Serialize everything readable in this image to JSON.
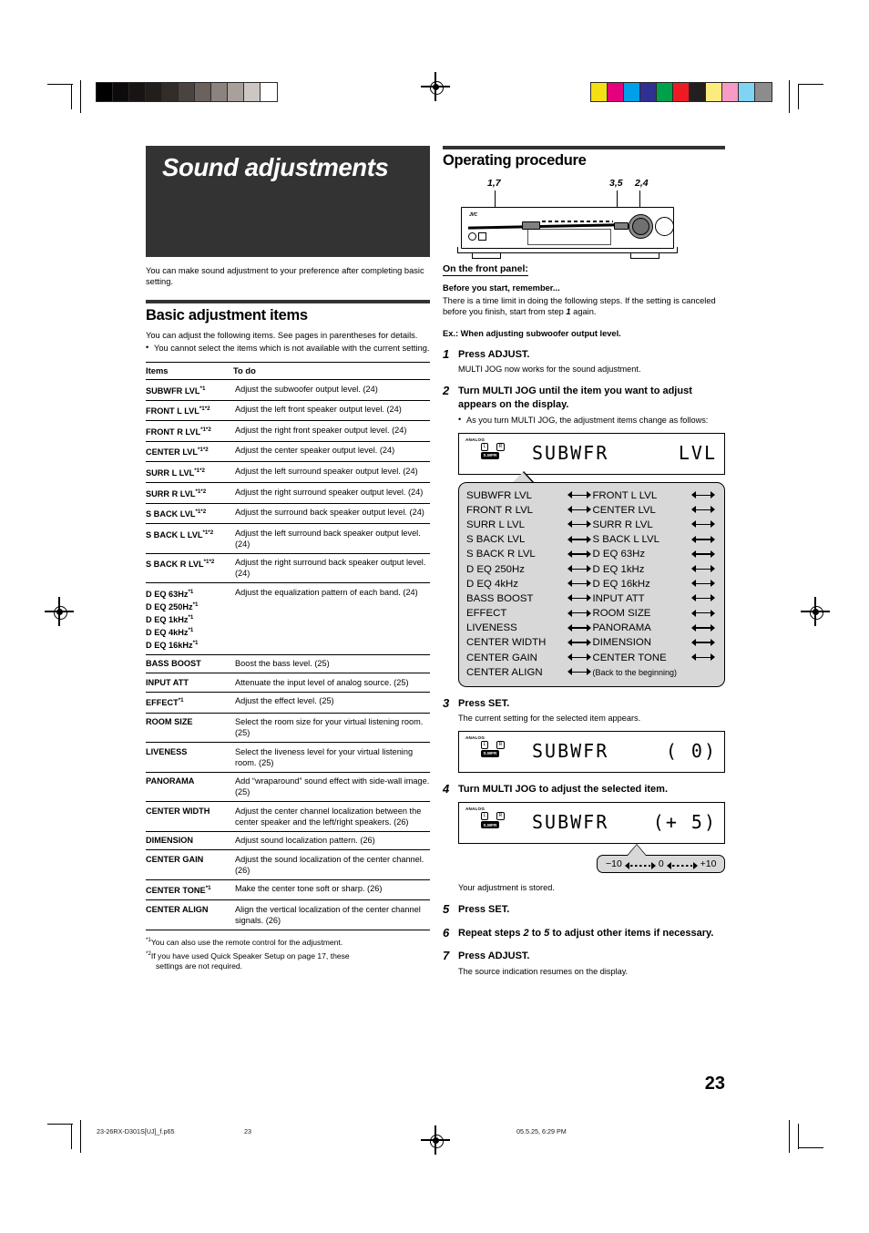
{
  "document": {
    "chapter_title": "Sound adjustments",
    "intro": "You can make sound adjustment to your preference after completing basic setting.",
    "page_number": "23"
  },
  "left_column": {
    "section_title": "Basic adjustment items",
    "lead": "You can adjust the following items. See pages in parentheses for details.",
    "bullet": "You cannot select the items which is not available with the current setting.",
    "table": {
      "headers": [
        "Items",
        "To do"
      ],
      "rows": [
        {
          "item": "SUBWFR LVL",
          "sup": "*1",
          "todo": "Adjust the subwoofer output level. (24)"
        },
        {
          "item": "FRONT L LVL",
          "sup": "*1*2",
          "todo": "Adjust the left front speaker output level. (24)"
        },
        {
          "item": "FRONT R LVL",
          "sup": "*1*2",
          "todo": "Adjust the right front speaker output level. (24)"
        },
        {
          "item": "CENTER LVL",
          "sup": "*1*2",
          "todo": "Adjust the center speaker output level. (24)"
        },
        {
          "item": "SURR L LVL",
          "sup": "*1*2",
          "todo": "Adjust the left surround speaker output level. (24)"
        },
        {
          "item": "SURR R LVL",
          "sup": "*1*2",
          "todo": "Adjust the right surround speaker output level. (24)"
        },
        {
          "item": "S BACK LVL",
          "sup": "*1*2",
          "todo": "Adjust the surround back speaker output level. (24)"
        },
        {
          "item": "S BACK L LVL",
          "sup": "*1*2",
          "todo": "Adjust the left surround back speaker output level. (24)"
        },
        {
          "item": "S BACK R LVL",
          "sup": "*1*2",
          "todo": "Adjust the right surround back speaker output level. (24)"
        },
        {
          "item": "D EQ 63Hz",
          "sup": "*1",
          "item2": "D EQ 250Hz",
          "sup2": "*1",
          "item3": "D EQ 1kHz",
          "sup3": "*1",
          "item4": "D EQ 4kHz",
          "sup4": "*1",
          "item5": "D EQ 16kHz",
          "sup5": "*1",
          "todo": "Adjust the equalization pattern of each band. (24)"
        },
        {
          "item": "BASS BOOST",
          "sup": "",
          "todo": "Boost the bass level. (25)"
        },
        {
          "item": "INPUT ATT",
          "sup": "",
          "todo": "Attenuate the input level of analog source. (25)"
        },
        {
          "item": "EFFECT",
          "sup": "*1",
          "todo": "Adjust the effect level. (25)"
        },
        {
          "item": "ROOM SIZE",
          "sup": "",
          "todo": "Select the room size for your virtual listening room. (25)"
        },
        {
          "item": "LIVENESS",
          "sup": "",
          "todo": "Select the liveness level for your virtual listening room. (25)"
        },
        {
          "item": "PANORAMA",
          "sup": "",
          "todo": "Add “wraparound” sound effect with side-wall image. (25)"
        },
        {
          "item": "CENTER WIDTH",
          "sup": "",
          "todo": "Adjust the center channel localization between the center speaker and the left/right speakers. (26)"
        },
        {
          "item": "DIMENSION",
          "sup": "",
          "todo": "Adjust sound localization pattern. (26)"
        },
        {
          "item": "CENTER GAIN",
          "sup": "",
          "todo": "Adjust the sound localization of the center channel. (26)"
        },
        {
          "item": "CENTER TONE",
          "sup": "*1",
          "todo": "Make the center tone soft or sharp. (26)"
        },
        {
          "item": "CENTER ALIGN",
          "sup": "",
          "todo": "Align the vertical localization of the center channel signals. (26)"
        }
      ]
    },
    "footnotes": [
      {
        "mark": "*1",
        "text": "You can also use the remote control for the adjustment."
      },
      {
        "mark": "*2",
        "text": "If you have used Quick Speaker Setup on page 17, these",
        "cont": "settings are not required."
      }
    ]
  },
  "right_column": {
    "section_title": "Operating procedure",
    "device_callouts": {
      "left": "1,7",
      "mid": "3,5",
      "right": "2,4"
    },
    "device_brand": "JVC",
    "on_front_panel": "On the front panel:",
    "before_title": "Before you start, remember...",
    "before_text_a": "There is a time limit in doing the following steps. If the setting is canceled before you finish, start from step ",
    "before_step": "1",
    "before_text_b": " again.",
    "example": "Ex.: When adjusting subwoofer output level.",
    "steps": [
      {
        "n": "1",
        "title": "Press ADJUST.",
        "detail": "MULTI JOG now works for the sound adjustment."
      },
      {
        "n": "2",
        "title": "Turn MULTI JOG until the item you want to adjust appears on the display.",
        "bullet": "As you turn MULTI JOG, the adjustment items change as follows:"
      },
      {
        "n": "3",
        "title": "Press SET.",
        "detail": "The current setting for the selected item appears."
      },
      {
        "n": "4",
        "title": "Turn MULTI JOG to adjust the selected item.",
        "after": "Your adjustment is stored."
      },
      {
        "n": "5",
        "title": "Press SET."
      },
      {
        "n": "6",
        "title_a": "Repeat steps ",
        "num_a": "2",
        "title_b": " to ",
        "num_b": "5",
        "title_c": " to adjust other items if necessary."
      },
      {
        "n": "7",
        "title": "Press ADJUST.",
        "detail": "The source indication resumes on the display."
      }
    ],
    "displays": [
      {
        "analog": "ANALOG",
        "l": "L",
        "r": "R",
        "swfr": "S.WFR",
        "left_text": "SUBWFR",
        "right_text": "LVL"
      },
      {
        "analog": "ANALOG",
        "l": "L",
        "r": "R",
        "swfr": "S.WFR",
        "left_text": "SUBWFR",
        "right_text": "(  0)"
      },
      {
        "analog": "ANALOG",
        "l": "L",
        "r": "R",
        "swfr": "S.WFR",
        "left_text": "SUBWFR",
        "right_text": "(+ 5)"
      }
    ],
    "flow_rows": [
      {
        "left": "SUBWFR LVL",
        "right": "FRONT L LVL"
      },
      {
        "left": "FRONT R LVL",
        "right": "CENTER LVL"
      },
      {
        "left": "SURR L LVL",
        "right": "SURR R LVL"
      },
      {
        "left": "S BACK LVL",
        "right": "S BACK L LVL"
      },
      {
        "left": "S BACK R LVL",
        "right": "D EQ 63Hz"
      },
      {
        "left": "D EQ 250Hz",
        "right": "D EQ 1kHz"
      },
      {
        "left": "D EQ 4kHz",
        "right": "D EQ 16kHz"
      },
      {
        "left": "BASS BOOST",
        "right": "INPUT ATT"
      },
      {
        "left": "EFFECT",
        "right": "ROOM SIZE"
      },
      {
        "left": "LIVENESS",
        "right": "PANORAMA"
      },
      {
        "left": "CENTER WIDTH",
        "right": "DIMENSION"
      },
      {
        "left": "CENTER GAIN",
        "right": "CENTER TONE"
      },
      {
        "left": "CENTER ALIGN",
        "right": "(Back to the beginning)",
        "last": true
      }
    ],
    "range": {
      "min": "−10",
      "mid": "0",
      "max": "+10"
    }
  },
  "print_marks": {
    "gray_swatches": [
      "#000000",
      "#0d0b0b",
      "#171413",
      "#221e1c",
      "#332d2a",
      "#4b4340",
      "#6b615d",
      "#8c827e",
      "#a9a09c",
      "#cdc7c4",
      "#ffffff"
    ],
    "color_swatches": [
      "#f5e014",
      "#e5007e",
      "#00a0e9",
      "#2e3192",
      "#00a14b",
      "#ed1c24",
      "#231f20",
      "#faed7d",
      "#f59bc4",
      "#7fd4f4",
      "#8c8c8c"
    ],
    "footer_file": "23-26RX-D301S[UJ]_f.p65",
    "footer_page": "23",
    "footer_timestamp": "05.5.25, 6:29 PM"
  }
}
